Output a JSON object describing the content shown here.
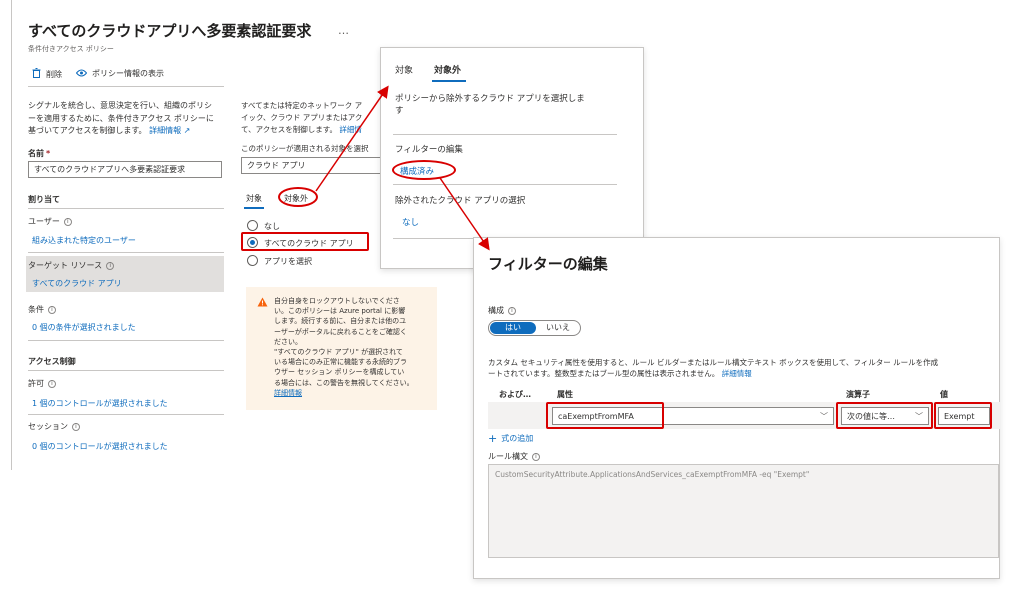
{
  "main": {
    "title": "すべてのクラウドアプリへ多要素認証要求",
    "more": "…",
    "subtitle": "条件付きアクセス ポリシー",
    "toolbar": {
      "delete_label": "削除",
      "view_info_label": "ポリシー情報の表示"
    },
    "description": [
      "シグナルを統合し、意思決定を行い、組織のポリシ",
      "ーを適用するために、条件付きアクセス ポリシーに",
      "基づいてアクセスを制御します。"
    ],
    "learn_more": "詳細情報",
    "name_label": "名前",
    "required_mark": "*",
    "name_value": "すべてのクラウドアプリへ多要素認証要求",
    "assignments_header": "割り当て",
    "users_label": "ユーザー",
    "users_value": "組み込まれた特定のユーザー",
    "target_label": "ターゲット リソース",
    "target_value": "すべてのクラウド アプリ",
    "conditions_label": "条件",
    "conditions_value": "0 個の条件が選択されました",
    "access_header": "アクセス制御",
    "grant_label": "許可",
    "grant_value": "1 個のコントロールが選択されました",
    "session_label": "セッション",
    "session_value": "0 個のコントロールが選択されました"
  },
  "middle": {
    "desc": [
      "すべてまたは特定のネットワーク ア",
      "イック、クラウド アプリまたはアク",
      "て、アクセスを制御します。"
    ],
    "learn_more": "詳細情",
    "applies_label": "このポリシーが適用される対象を選択",
    "dropdown_value": "クラウド アプリ",
    "tab_include": "対象",
    "tab_exclude": "対象外",
    "radio_none": "なし",
    "radio_all": "すべてのクラウド アプリ",
    "radio_select": "アプリを選択",
    "warning_lines": [
      "自分自身をロックアウトしないでくださ",
      "い。このポリシーは Azure portal に影響",
      "します。続行する前に、自分または他のユ",
      "ーザーがポータルに戻れることをご確認く",
      "ださい。",
      "\"すべてのクラウド アプリ\" が選択されて",
      "いる場合にのみ正常に機能する永続的ブラ",
      "ウザー セッション ポリシーを構成してい",
      "る場合には、この警告を無視してください。"
    ],
    "warning_link": "詳細情報"
  },
  "exclude_panel": {
    "tab_include": "対象",
    "tab_exclude": "対象外",
    "desc": [
      "ポリシーから除外するクラウド アプリを選択しま",
      "す"
    ],
    "filter_header": "フィルターの編集",
    "filter_value": "構成済み",
    "excluded_header": "除外されたクラウド アプリの選択",
    "excluded_value": "なし"
  },
  "filter_panel": {
    "title": "フィルターの編集",
    "configure_label": "構成",
    "toggle_yes": "はい",
    "toggle_no": "いいえ",
    "desc": [
      "カスタム セキュリティ属性を使用すると、ルール ビルダーまたはルール構文テキスト ボックスを使用して、フィルター ルールを作成",
      "ートされています。整数型またはブール型の属性は表示されません。"
    ],
    "learn_more": "詳細情報",
    "col_andor": "および…",
    "col_attribute": "属性",
    "col_operator": "演算子",
    "col_value": "値",
    "attribute_value": "caExemptFromMFA",
    "operator_value": "次の値に等…",
    "value_value": "Exempt",
    "add_expression": "式の追加",
    "rule_syntax_label": "ルール構文",
    "rule_syntax_value": "CustomSecurityAttribute.ApplicationsAndServices_caExemptFromMFA -eq \"Exempt\""
  },
  "colors": {
    "accent": "#0f6cbd",
    "annotation": "#d80000",
    "warning_bg": "#fdf3e7",
    "warning_icon": "#f7630c"
  }
}
